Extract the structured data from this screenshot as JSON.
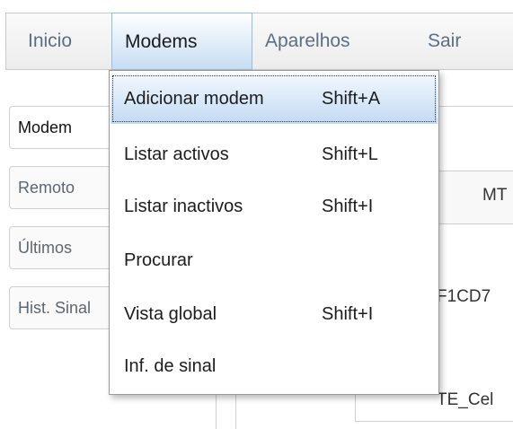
{
  "menubar": {
    "items": [
      {
        "label": "Inicio"
      },
      {
        "label": "Modems"
      },
      {
        "label": "Aparelhos"
      },
      {
        "label": "Sair"
      }
    ]
  },
  "side_tabs": [
    {
      "label": "Modem"
    },
    {
      "label": "Remoto"
    },
    {
      "label": "Últimos"
    },
    {
      "label": "Hist. Sinal"
    }
  ],
  "background": {
    "column_header": "MT",
    "cell_id": "F1CD7",
    "cell_name": "TE_Cel"
  },
  "modems_menu": {
    "items": [
      {
        "label": "Adicionar modem",
        "shortcut": "Shift+A"
      },
      {
        "label": "Listar activos",
        "shortcut": "Shift+L"
      },
      {
        "label": "Listar inactivos",
        "shortcut": "Shift+I"
      },
      {
        "label": "Procurar",
        "shortcut": ""
      },
      {
        "label": "Vista global",
        "shortcut": "Shift+I"
      },
      {
        "label": "Inf. de sinal",
        "shortcut": ""
      }
    ],
    "highlighted_index": 0
  }
}
